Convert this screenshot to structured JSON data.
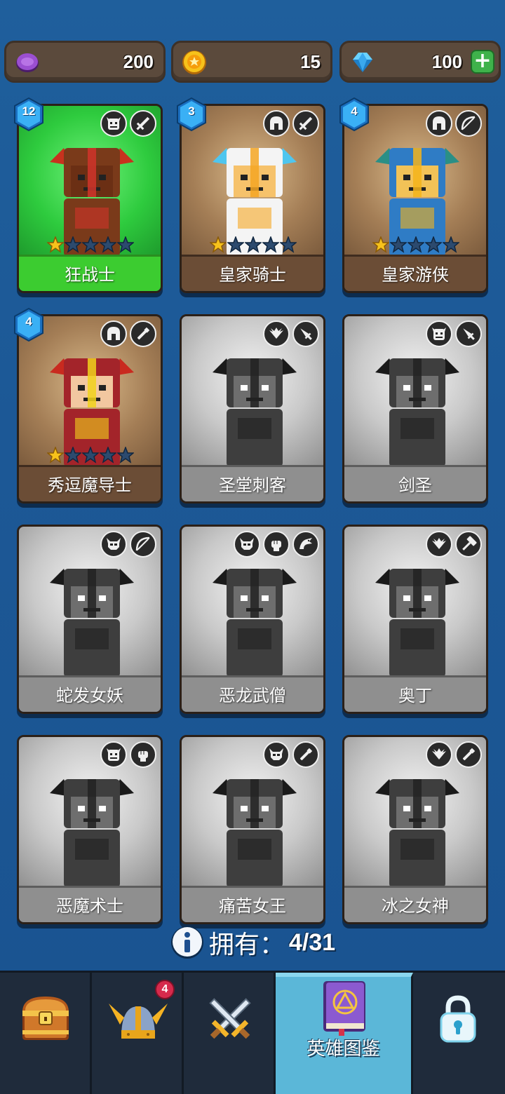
{
  "currencies": {
    "purple_gems": "200",
    "coins": "15",
    "diamonds": "100"
  },
  "heroes": [
    {
      "name": "狂战士",
      "level": "12",
      "state": "active",
      "stars": 1,
      "class_icons": [
        "orc-face-icon",
        "sword-icon"
      ]
    },
    {
      "name": "皇家骑士",
      "level": "3",
      "state": "owned",
      "stars": 1,
      "class_icons": [
        "spartan-helmet-icon",
        "sword-icon"
      ]
    },
    {
      "name": "皇家游侠",
      "level": "4",
      "state": "owned",
      "stars": 1,
      "class_icons": [
        "spartan-helmet-icon",
        "bow-icon"
      ]
    },
    {
      "name": "秀逗魔导士",
      "level": "4",
      "state": "owned",
      "stars": 1,
      "class_icons": [
        "spartan-helmet-icon",
        "wand-icon"
      ]
    },
    {
      "name": "圣堂刺客",
      "state": "locked",
      "class_icons": [
        "winged-emblem-icon",
        "dagger-icon"
      ]
    },
    {
      "name": "剑圣",
      "state": "locked",
      "class_icons": [
        "orc-face-icon",
        "dagger-icon"
      ]
    },
    {
      "name": "蛇发女妖",
      "state": "locked",
      "class_icons": [
        "demon-skull-icon",
        "bow-icon"
      ]
    },
    {
      "name": "恶龙武僧",
      "state": "locked",
      "class_icons": [
        "demon-skull-icon",
        "fist-icon",
        "dragon-icon"
      ]
    },
    {
      "name": "奥丁",
      "state": "locked",
      "class_icons": [
        "winged-emblem-icon",
        "hammer-icon"
      ]
    },
    {
      "name": "恶魔术士",
      "state": "locked",
      "class_icons": [
        "orc-face-icon",
        "fist-icon"
      ]
    },
    {
      "name": "痛苦女王",
      "state": "locked",
      "class_icons": [
        "demon-skull-icon",
        "wand-icon"
      ]
    },
    {
      "name": "冰之女神",
      "state": "locked",
      "class_icons": [
        "winged-emblem-icon",
        "wand-icon"
      ]
    }
  ],
  "owned": {
    "label": "拥有：",
    "count": "4/31"
  },
  "nav": {
    "tabs": [
      {
        "icon": "treasure-chest-icon"
      },
      {
        "icon": "winged-helmet-icon",
        "notification": "4"
      },
      {
        "icon": "crossed-swords-icon"
      },
      {
        "icon": "spellbook-icon",
        "label": "英雄图鉴",
        "active": true
      },
      {
        "icon": "lock-icon"
      }
    ]
  },
  "colors": {
    "background": "#1c5896",
    "active_card": "#3ccc30",
    "owned_card": "#6b4d36",
    "locked_card": "#8f8f8f",
    "active_tab": "#5bb7d8"
  }
}
